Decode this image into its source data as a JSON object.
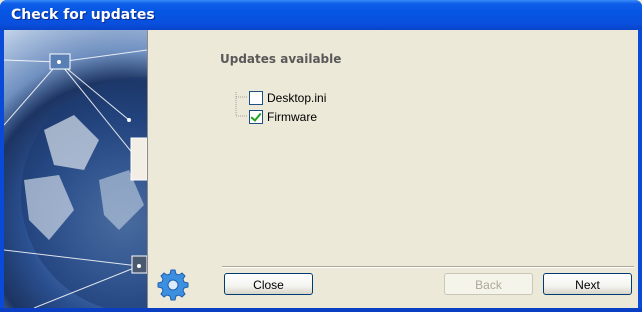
{
  "window": {
    "title": "Check for updates"
  },
  "content": {
    "heading": "Updates available",
    "items": [
      {
        "label": "Desktop.ini",
        "checked": false
      },
      {
        "label": "Firmware",
        "checked": true
      }
    ]
  },
  "buttons": {
    "close": {
      "label": "Close",
      "enabled": true
    },
    "back": {
      "label": "Back",
      "enabled": false
    },
    "next": {
      "label": "Next",
      "enabled": true
    }
  },
  "icons": {
    "side_image": "globe-network-image",
    "wizard": "gear-icon"
  },
  "colors": {
    "titlebar": "#0656e4",
    "client": "#ece9d8",
    "checkmark": "#21a121"
  }
}
